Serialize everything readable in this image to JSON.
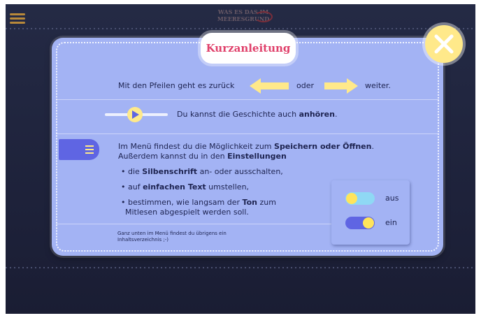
{
  "header": {
    "logo_line1": "WAS ES DAS IM",
    "logo_line2": "MEERESGRUND"
  },
  "dialog": {
    "title": "Kurzanleitung",
    "arrows_row": {
      "text_before": "Mit den Pfeilen geht es zurück",
      "text_middle": "oder",
      "text_after": "weiter."
    },
    "audio_row": {
      "text_pre": "Du kannst die Geschichte auch ",
      "text_bold": "anhören",
      "text_post": "."
    },
    "menu_section": {
      "line1_pre": "Im Menü findest du die Möglichkeit zum ",
      "line1_bold": "Speichern oder Öffnen",
      "line1_post": ".",
      "line2_pre": "Außerdem kannst du in den ",
      "line2_bold": "Einstellungen",
      "bullet1_pre": "• die ",
      "bullet1_bold": "Silbenschrift",
      "bullet1_post": " an- oder ausschalten,",
      "bullet2_pre": "• auf ",
      "bullet2_bold": "einfachen Text",
      "bullet2_post": " umstellen,",
      "bullet3_pre": "• bestimmen, wie langsam der ",
      "bullet3_bold": "Ton",
      "bullet3_post": " zum",
      "bullet3_line2": "Mitlesen abgespielt werden soll."
    },
    "legend": {
      "off_label": "aus",
      "on_label": "ein"
    },
    "footer_line1": "Ganz unten im Menü findest du übrigens ein",
    "footer_line2": "Inhaltsverzeichnis ;-)"
  },
  "colors": {
    "card": "#a3b3f4",
    "title_text": "#e0406a",
    "accent_yellow": "#ffe98a",
    "toggle_on": "#5f65e3",
    "toggle_off": "#8fd8f4",
    "background": "#1f2440"
  },
  "icons": [
    "hamburger-icon",
    "close-icon",
    "arrow-left-icon",
    "arrow-right-icon",
    "play-icon",
    "menu-icon"
  ]
}
